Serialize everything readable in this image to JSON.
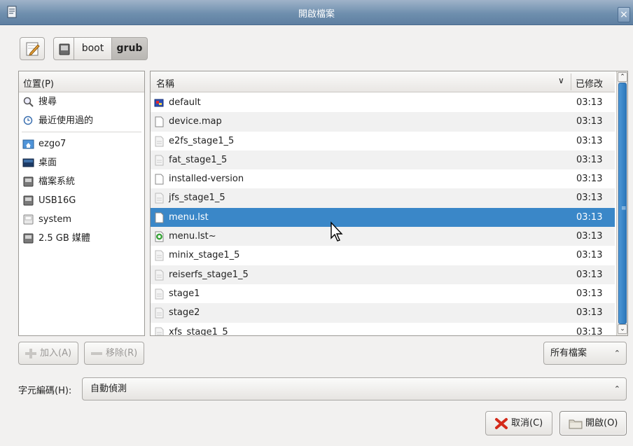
{
  "window": {
    "title": "開啟檔案",
    "close_glyph": "×",
    "icon": "document-icon"
  },
  "path_bar": {
    "edit_icon": "pencil-icon",
    "disk_icon": "disk-icon",
    "segments": [
      "boot",
      "grub"
    ],
    "active_segment": "grub"
  },
  "places": {
    "header": "位置(P)",
    "items": [
      {
        "label": "搜尋",
        "icon": "search-icon"
      },
      {
        "label": "最近使用過的",
        "icon": "recent-icon"
      },
      {
        "label": "ezgo7",
        "icon": "home-folder-icon"
      },
      {
        "label": "桌面",
        "icon": "desktop-icon"
      },
      {
        "label": "檔案系統",
        "icon": "drive-icon"
      },
      {
        "label": "USB16G",
        "icon": "drive-icon"
      },
      {
        "label": "system",
        "icon": "drive-icon"
      },
      {
        "label": "2.5 GB 媒體",
        "icon": "drive-icon"
      }
    ]
  },
  "files": {
    "col_name": "名稱",
    "col_modified": "已修改",
    "sort_glyph": "∨",
    "rows": [
      {
        "name": "default",
        "time": "03:13",
        "icon": "image-file-icon"
      },
      {
        "name": "device.map",
        "time": "03:13",
        "icon": "text-file-icon"
      },
      {
        "name": "e2fs_stage1_5",
        "time": "03:13",
        "icon": "file-icon"
      },
      {
        "name": "fat_stage1_5",
        "time": "03:13",
        "icon": "file-icon"
      },
      {
        "name": "installed-version",
        "time": "03:13",
        "icon": "text-file-icon"
      },
      {
        "name": "jfs_stage1_5",
        "time": "03:13",
        "icon": "file-icon"
      },
      {
        "name": "menu.lst",
        "time": "03:13",
        "icon": "text-file-icon",
        "selected": true
      },
      {
        "name": "menu.lst~",
        "time": "03:13",
        "icon": "backup-file-icon"
      },
      {
        "name": "minix_stage1_5",
        "time": "03:13",
        "icon": "file-icon"
      },
      {
        "name": "reiserfs_stage1_5",
        "time": "03:13",
        "icon": "file-icon"
      },
      {
        "name": "stage1",
        "time": "03:13",
        "icon": "file-icon"
      },
      {
        "name": "stage2",
        "time": "03:13",
        "icon": "file-icon"
      },
      {
        "name": "xfs_stage1_5",
        "time": "03:13",
        "icon": "file-icon"
      }
    ]
  },
  "buttons": {
    "add": "加入(A)",
    "remove": "移除(R)",
    "cancel": "取消(C)",
    "open": "開啟(O)"
  },
  "filter": {
    "value": "所有檔案"
  },
  "encoding": {
    "label": "字元編碼(H):",
    "value": "自動偵測"
  },
  "colors": {
    "selection": "#3a87c8",
    "titlebar": "#6f8fae"
  }
}
